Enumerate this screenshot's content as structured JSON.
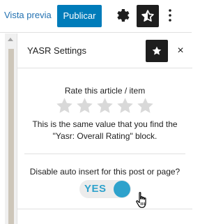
{
  "toolbar": {
    "preview_label": "Vista previa",
    "publish_label": "Publicar",
    "settings_icon": "gear-icon",
    "yasr_icon": "star-half-icon",
    "more_icon": "vertical-dots-icon"
  },
  "panel": {
    "title": "YASR Settings",
    "star_icon": "star-icon",
    "close_symbol": "×",
    "rate_label": "Rate this article / item",
    "rating_value": 0,
    "rating_max": 5,
    "rating_note": "This is the same value that you find the \"Yasr: Overall Rating\" block.",
    "auto_insert_label": "Disable auto insert for this post or page?",
    "toggle_text": "YES",
    "toggle_on": true
  },
  "colors": {
    "accent": "#007cba",
    "toggle": "#2ea2cc",
    "dark": "#1e1e1e",
    "star_empty": "#d9d9d9"
  }
}
